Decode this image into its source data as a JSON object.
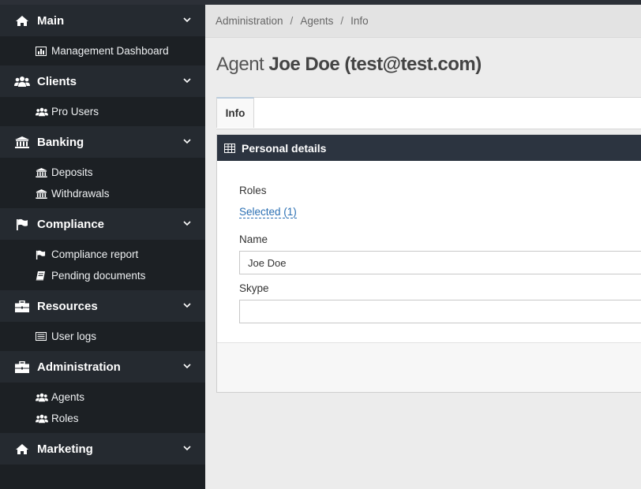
{
  "sidebar": {
    "sections": [
      {
        "label": "Main",
        "icon": "home-icon",
        "items": [
          {
            "label": "Management Dashboard",
            "icon": "bar-chart-icon"
          }
        ]
      },
      {
        "label": "Clients",
        "icon": "users-icon",
        "items": [
          {
            "label": "Pro Users",
            "icon": "users-icon"
          }
        ]
      },
      {
        "label": "Banking",
        "icon": "bank-icon",
        "items": [
          {
            "label": "Deposits",
            "icon": "bank-icon"
          },
          {
            "label": "Withdrawals",
            "icon": "bank-icon"
          }
        ]
      },
      {
        "label": "Compliance",
        "icon": "flag-icon",
        "items": [
          {
            "label": "Compliance report",
            "icon": "flag-icon"
          },
          {
            "label": "Pending documents",
            "icon": "book-icon"
          }
        ]
      },
      {
        "label": "Resources",
        "icon": "briefcase-icon",
        "items": [
          {
            "label": "User logs",
            "icon": "list-icon"
          }
        ]
      },
      {
        "label": "Administration",
        "icon": "briefcase-icon",
        "items": [
          {
            "label": "Agents",
            "icon": "users-icon"
          },
          {
            "label": "Roles",
            "icon": "users-icon"
          }
        ]
      },
      {
        "label": "Marketing",
        "icon": "home-icon",
        "items": []
      }
    ]
  },
  "breadcrumb": {
    "items": [
      "Administration",
      "Agents",
      "Info"
    ],
    "separator": "/"
  },
  "page": {
    "title_prefix": "Agent",
    "title_name": "Joe Doe (test@test.com)"
  },
  "tabs": [
    {
      "label": "Info",
      "active": true
    }
  ],
  "panel": {
    "title": "Personal details",
    "title_icon": "table-icon",
    "roles_label": "Roles",
    "roles_value": "Selected (1)",
    "name_label": "Name",
    "name_value": "Joe Doe",
    "skype_label": "Skype",
    "skype_value": ""
  },
  "colors": {
    "sidebar_bg": "#1c2024",
    "sidebar_section_bg": "#252a30",
    "panel_header_bg": "#2c3440",
    "link": "#2a6fb3"
  }
}
